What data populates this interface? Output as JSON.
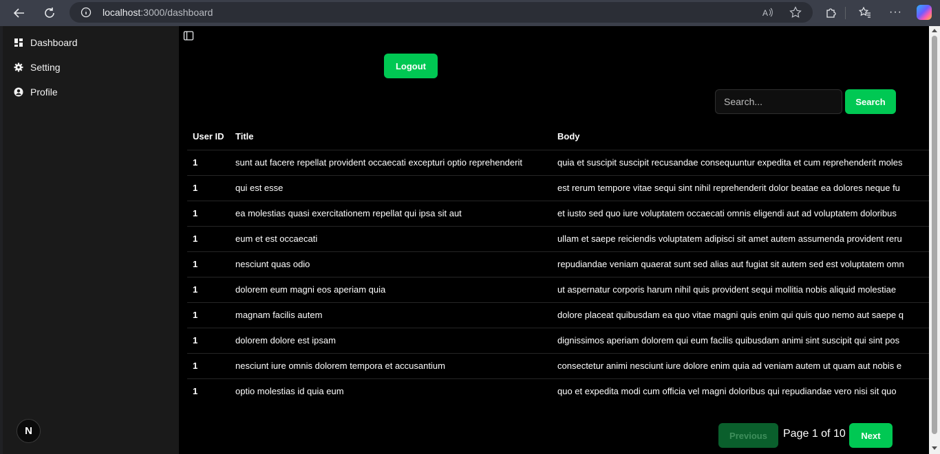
{
  "browser": {
    "url_host": "localhost",
    "url_path": ":3000/dashboard"
  },
  "sidebar": {
    "items": [
      {
        "label": "Dashboard",
        "icon": "dashboard-icon"
      },
      {
        "label": "Setting",
        "icon": "gear-icon"
      },
      {
        "label": "Profile",
        "icon": "user-circle-icon"
      }
    ],
    "logo": "N"
  },
  "main": {
    "logout_label": "Logout",
    "search_placeholder": "Search...",
    "search_label": "Search",
    "table": {
      "headers": [
        "User ID",
        "Title",
        "Body"
      ],
      "rows": [
        {
          "uid": "1",
          "title": "sunt aut facere repellat provident occaecati excepturi optio reprehenderit",
          "body": "quia et suscipit suscipit recusandae consequuntur expedita et cum reprehenderit moles"
        },
        {
          "uid": "1",
          "title": "qui est esse",
          "body": "est rerum tempore vitae sequi sint nihil reprehenderit dolor beatae ea dolores neque fu"
        },
        {
          "uid": "1",
          "title": "ea molestias quasi exercitationem repellat qui ipsa sit aut",
          "body": "et iusto sed quo iure voluptatem occaecati omnis eligendi aut ad voluptatem doloribus"
        },
        {
          "uid": "1",
          "title": "eum et est occaecati",
          "body": "ullam et saepe reiciendis voluptatem adipisci sit amet autem assumenda provident reru"
        },
        {
          "uid": "1",
          "title": "nesciunt quas odio",
          "body": "repudiandae veniam quaerat sunt sed alias aut fugiat sit autem sed est voluptatem omn"
        },
        {
          "uid": "1",
          "title": "dolorem eum magni eos aperiam quia",
          "body": "ut aspernatur corporis harum nihil quis provident sequi mollitia nobis aliquid molestiae"
        },
        {
          "uid": "1",
          "title": "magnam facilis autem",
          "body": "dolore placeat quibusdam ea quo vitae magni quis enim qui quis quo nemo aut saepe q"
        },
        {
          "uid": "1",
          "title": "dolorem dolore est ipsam",
          "body": "dignissimos aperiam dolorem qui eum facilis quibusdam animi sint suscipit qui sint pos"
        },
        {
          "uid": "1",
          "title": "nesciunt iure omnis dolorem tempora et accusantium",
          "body": "consectetur animi nesciunt iure dolore enim quia ad veniam autem ut quam aut nobis e"
        },
        {
          "uid": "1",
          "title": "optio molestias id quia eum",
          "body": "quo et expedita modi cum officia vel magni doloribus qui repudiandae vero nisi sit quo"
        }
      ]
    },
    "pagination": {
      "previous_label": "Previous",
      "page_text": "Page 1 of 10",
      "next_label": "Next"
    }
  },
  "colors": {
    "accent": "#00c853",
    "accent_disabled": "#0a5f2c"
  }
}
